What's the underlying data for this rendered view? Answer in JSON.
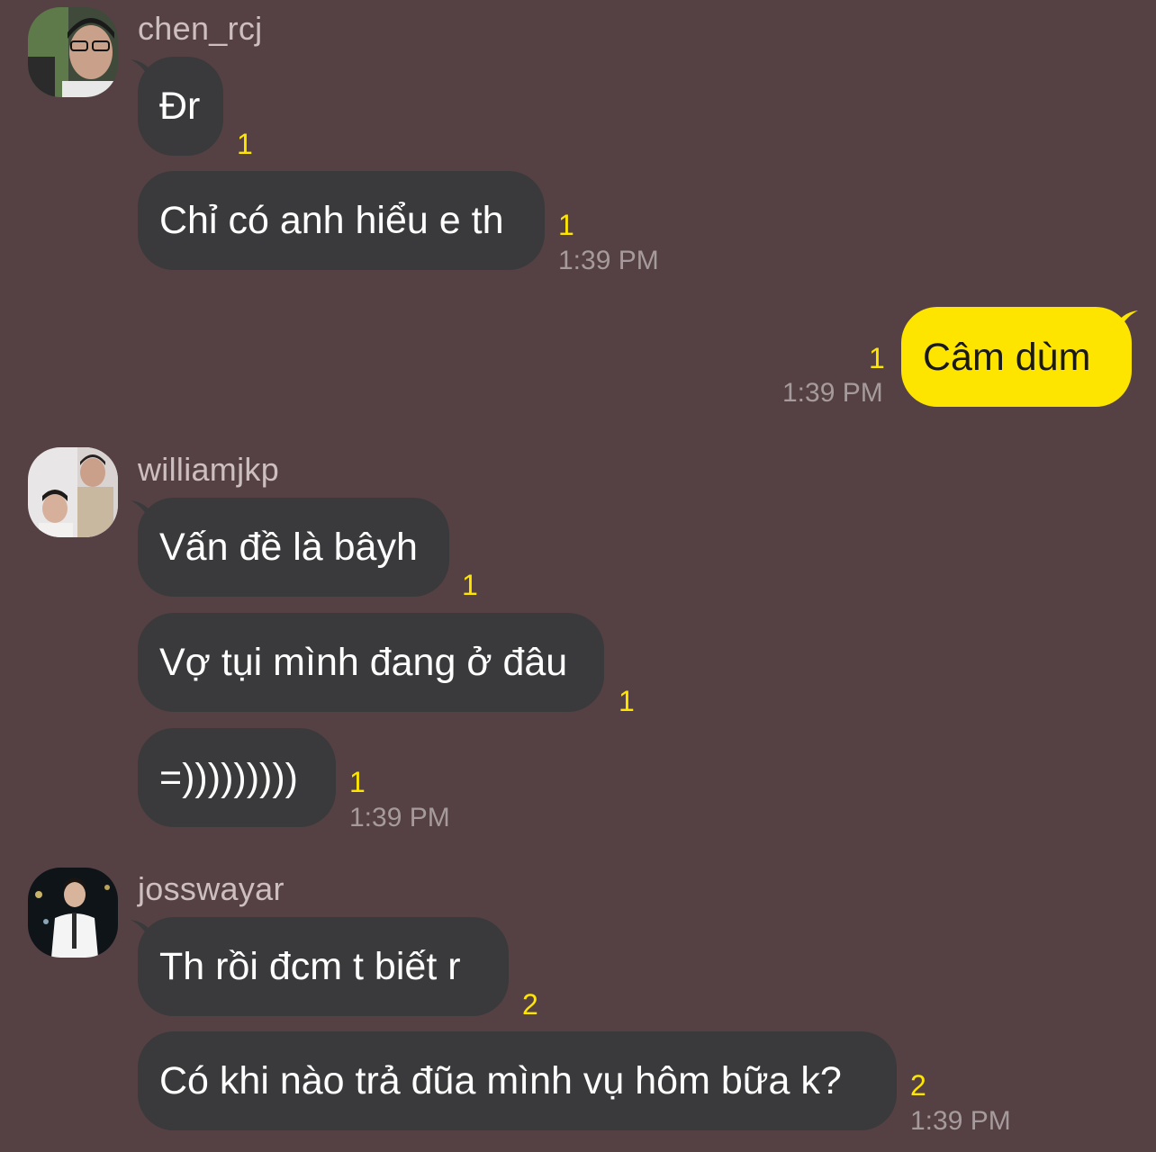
{
  "theme": {
    "background": "#554143",
    "bubble_other": "#3a3a3c",
    "bubble_mine": "#fee500",
    "unread_color": "#ffe600",
    "time_color": "#a69b9c",
    "sender_color": "#cdbfc0"
  },
  "groups": [
    {
      "sender": "chen_rcj",
      "avatar": "user-photo-avatar",
      "messages": [
        {
          "text": "Đr",
          "unread": "1",
          "time": ""
        },
        {
          "text": "Chỉ có anh hiểu e th",
          "unread": "1",
          "time": "1:39 PM"
        }
      ]
    },
    {
      "sender": "me",
      "messages": [
        {
          "text": "Câm dùm",
          "unread": "1",
          "time": "1:39 PM"
        }
      ]
    },
    {
      "sender": "williamjkp",
      "avatar": "user-photo-avatar",
      "messages": [
        {
          "text": "Vấn đề là bâyh",
          "unread": "1",
          "time": ""
        },
        {
          "text": "Vợ tụi mình đang ở đâu",
          "unread": "1",
          "time": ""
        },
        {
          "text": "=)))))))))",
          "unread": "1",
          "time": "1:39 PM"
        }
      ]
    },
    {
      "sender": "josswayar",
      "avatar": "user-photo-avatar",
      "messages": [
        {
          "text": "Th rồi đcm t biết r",
          "unread": "2",
          "time": ""
        },
        {
          "text": "Có khi nào trả đũa mình vụ hôm bữa k?",
          "unread": "2",
          "time": "1:39 PM"
        }
      ]
    }
  ]
}
